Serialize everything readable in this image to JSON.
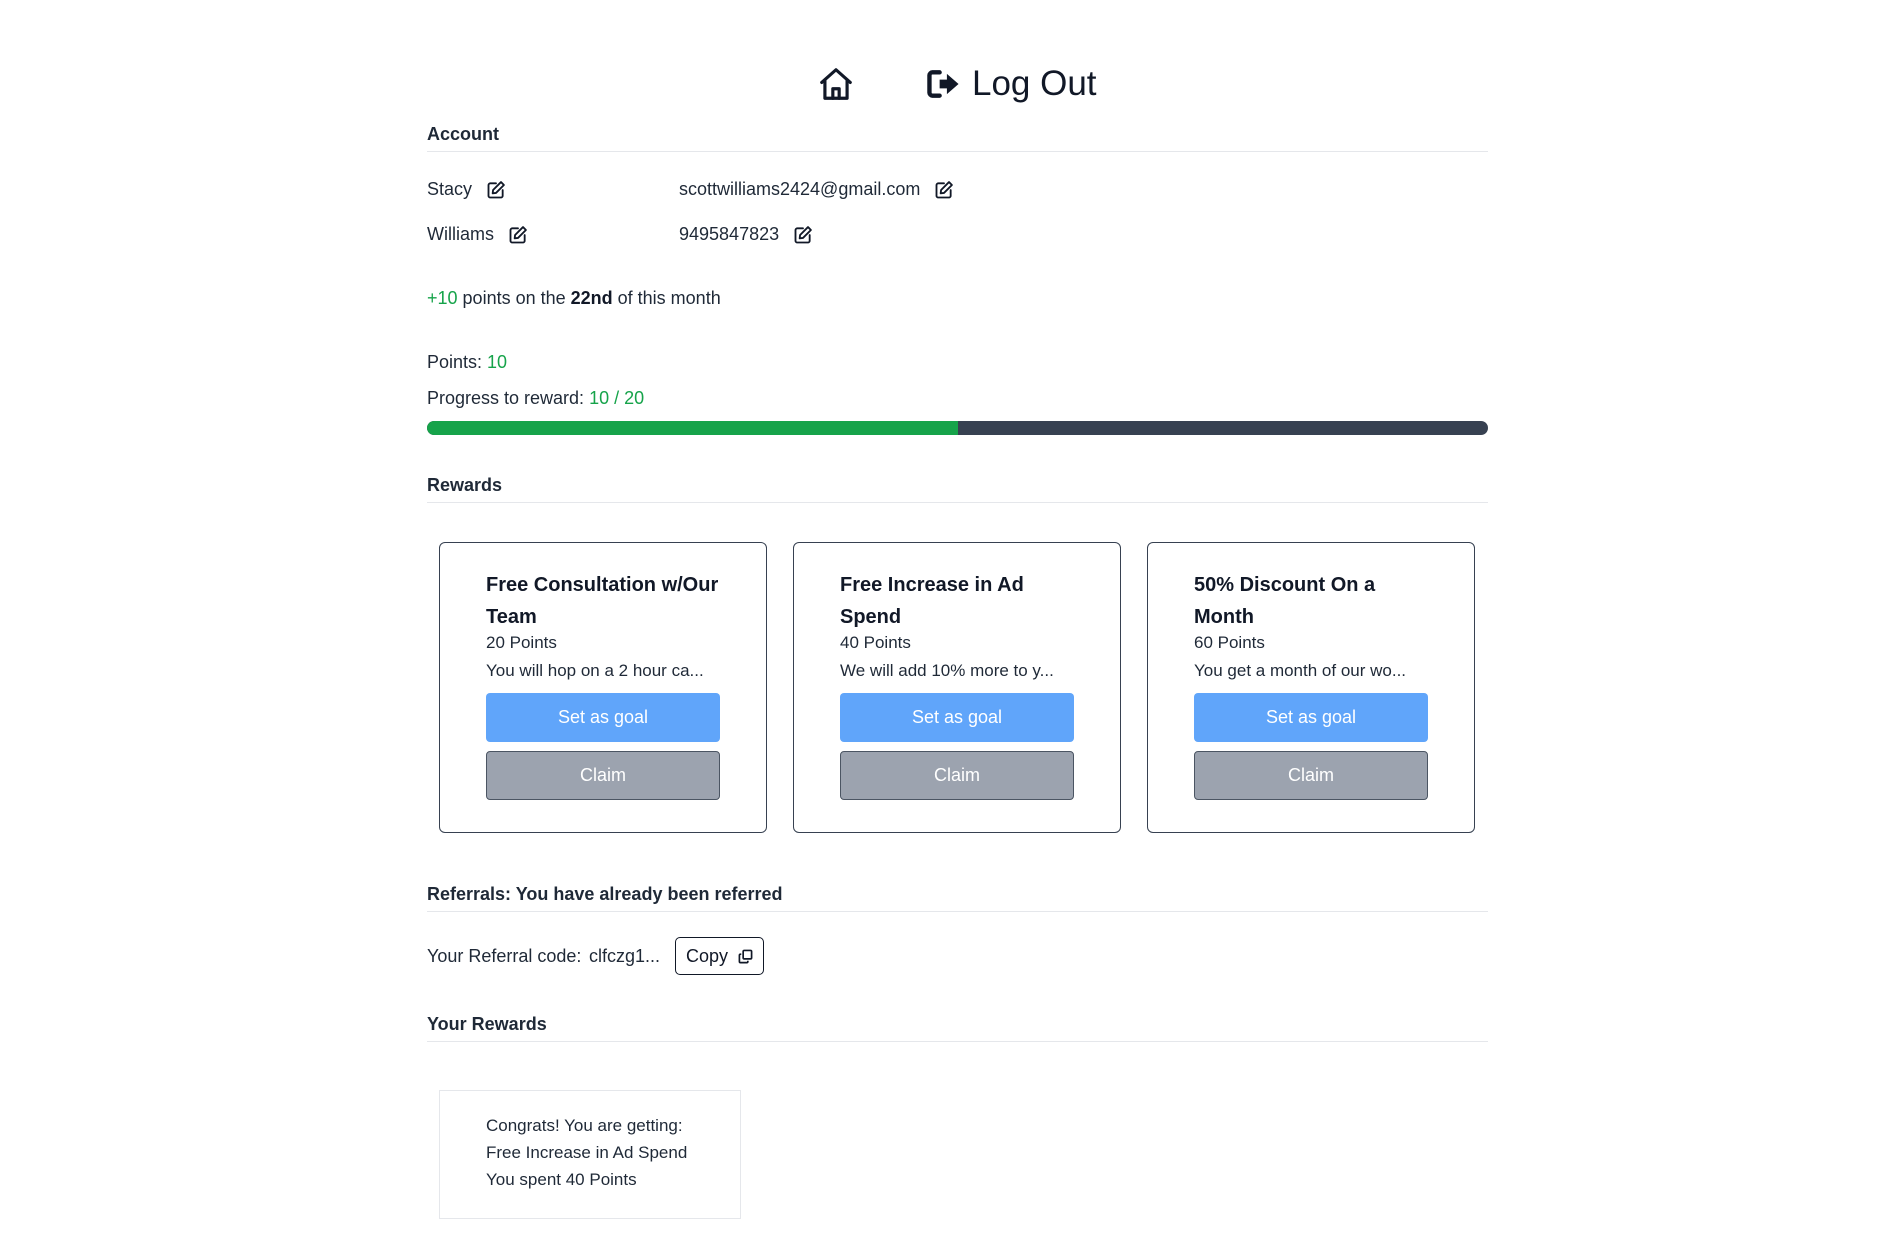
{
  "nav": {
    "home_icon": "home-icon",
    "logout_icon": "sign-out-icon",
    "logout_label": "Log Out"
  },
  "account": {
    "section_title": "Account",
    "first_name": "Stacy",
    "last_name": "Williams",
    "email": "scottwilliams2424@gmail.com",
    "phone": "9495847823",
    "edit_icon": "edit-icon"
  },
  "monthly_bonus": {
    "amount": "+10",
    "text_before_day": " points on the ",
    "day": "22nd",
    "text_after_day": " of this month"
  },
  "points": {
    "label": "Points: ",
    "value": "10"
  },
  "progress": {
    "label": "Progress to reward: ",
    "value_text": "10 / 20",
    "current": 10,
    "target": 20,
    "fill_color": "#16a34a",
    "track_color": "#374151"
  },
  "rewards": {
    "section_title": "Rewards",
    "cards": [
      {
        "title": "Free Consultation w/Our Team",
        "points": "20 Points",
        "description": "You will hop on a 2 hour ca...",
        "goal_label": "Set as goal",
        "claim_label": "Claim"
      },
      {
        "title": "Free Increase in Ad Spend",
        "points": "40 Points",
        "description": "We will add 10% more to y...",
        "goal_label": "Set as goal",
        "claim_label": "Claim"
      },
      {
        "title": "50% Discount On a Month",
        "points": "60 Points",
        "description": "You get a month of our wo...",
        "goal_label": "Set as goal",
        "claim_label": "Claim"
      }
    ]
  },
  "referrals": {
    "section_title": "Referrals: You have already been referred",
    "code_label": "Your Referral code:",
    "code_value": "clfczg1...",
    "copy_label": "Copy",
    "copy_icon": "copy-icon"
  },
  "your_rewards": {
    "section_title": "Your Rewards",
    "items": [
      {
        "line1": "Congrats! You are getting:",
        "line2": "Free Increase in Ad Spend",
        "line3": "You spent 40 Points"
      }
    ]
  }
}
